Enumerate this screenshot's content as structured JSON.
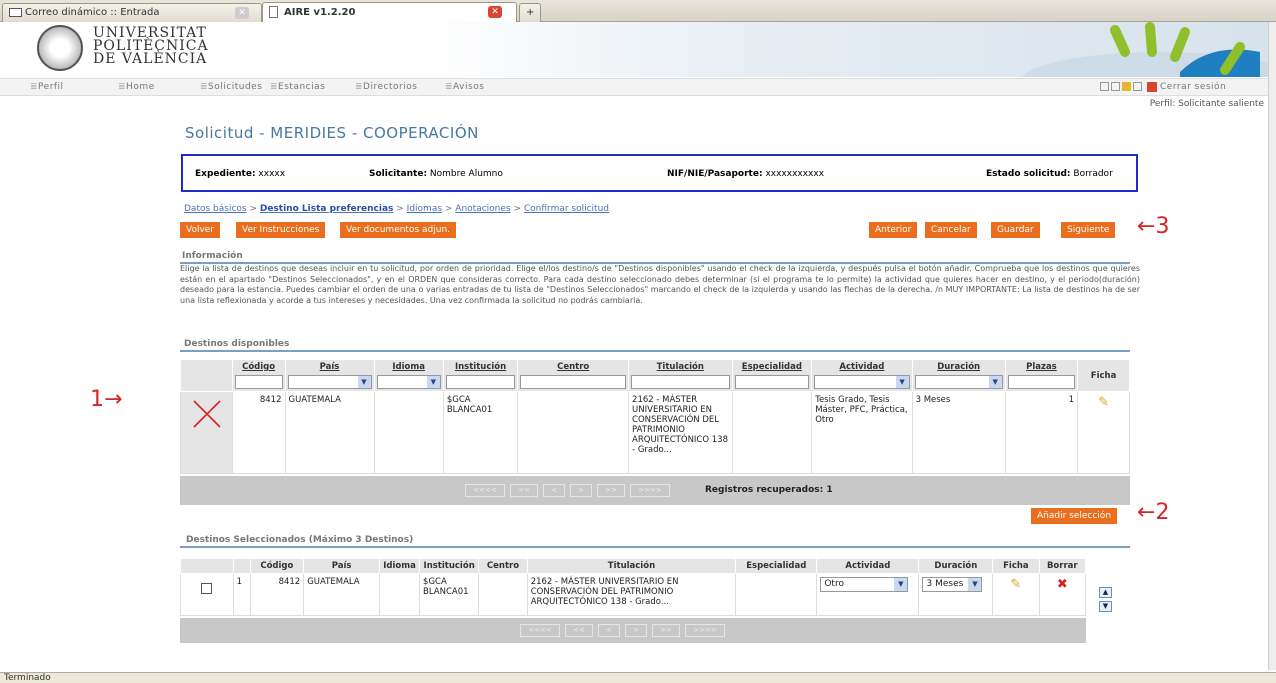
{
  "browser": {
    "tabs": [
      {
        "label": "Correo dinámico :: Entrada",
        "active": false
      },
      {
        "label": "AIRE v1.2.20",
        "active": true
      }
    ],
    "new_tab": "+",
    "status_text": "Terminado"
  },
  "header": {
    "logo_lines": [
      "UNIVERSITAT",
      "POLITÈCNICA",
      "DE VALÈNCIA"
    ]
  },
  "nav": {
    "items": [
      "Perfil",
      "Home",
      "Solicitudes",
      "Estancias",
      "Directorios",
      "Avisos"
    ],
    "logout": "Cerrar sesión",
    "profile": "Perfil: Solicitante saliente"
  },
  "page": {
    "title": "Solicitud - MERIDIES - COOPERACIÓN",
    "summary": {
      "expediente_label": "Expediente:",
      "expediente_value": "xxxxx",
      "solicitante_label": "Solicitante:",
      "solicitante_value": "Nombre Alumno",
      "nif_label": "NIF/NIE/Pasaporte:",
      "nif_value": "xxxxxxxxxxx",
      "estado_label": "Estado solicitud:",
      "estado_value": "Borrador"
    },
    "breadcrumb": [
      "Datos básicos",
      "Destino Lista preferencias",
      "Idiomas",
      "Anotaciones",
      "Confirmar solicitud"
    ],
    "left_buttons": [
      "Volver",
      "Ver Instrucciones",
      "Ver documentos adjun."
    ],
    "right_buttons": [
      "Anterior",
      "Cancelar",
      "Guardar",
      "Siguiente"
    ],
    "info_heading": "Información",
    "info_text": "Elige la lista de destinos que deseas incluir en tu solicitud, por orden de prioridad. Elige el/los destino/s de \"Destinos disponibles\" usando el check de la izquierda, y después pulsa el botón añadir. Comprueba que los destinos que quieres están en el apartado \"Destinos Seleccionados\", y en el ORDEN que consideras correcto. Para cada destino seleccionado debes determinar (si el programa te lo permite) la actividad que quieres hacer en destino, y el periodo(duración) deseado para la estancia. Puedes cambiar el orden de una o varias entradas de tu lista de \"Destinos Seleccionados\" marcando el check de la izquierda y usando las flechas de la derecha. /n MUY IMPORTANTE: La lista de destinos ha de ser una lista reflexionada y acorde a tus intereses y necesidades. Una vez confirmada la solicitud no podrás cambiarla.",
    "available_heading": "Destinos disponibles",
    "available": {
      "columns": [
        "Código",
        "País",
        "Idioma",
        "Institución",
        "Centro",
        "Titulación",
        "Especialidad",
        "Actividad",
        "Duración",
        "Plazas",
        "Ficha"
      ],
      "row": {
        "codigo": "8412",
        "pais": "GUATEMALA",
        "idioma": "",
        "institucion": "$GCA BLANCA01",
        "centro": "",
        "titulacion": "2162 - MÁSTER UNIVERSITARIO EN CONSERVACIÓN DEL PATRIMONIO ARQUITECTÓNICO 138 - Grado...",
        "especialidad": "",
        "actividad": "Tesis Grado, Tesis Máster, PFC, Práctica, Otro",
        "duracion": "3 Meses",
        "plazas": "1"
      },
      "pager": [
        "<<<<",
        "<<",
        "<",
        ">",
        ">>",
        ">>>>"
      ],
      "records_text": "Registros recuperados: 1"
    },
    "add_button": "Añadir selección",
    "selected_heading": "Destinos Seleccionados (Máximo 3 Destinos)",
    "selected": {
      "columns": [
        "Código",
        "País",
        "Idioma",
        "Institución",
        "Centro",
        "Titulación",
        "Especialidad",
        "Actividad",
        "Duración",
        "Ficha",
        "Borrar"
      ],
      "row": {
        "num": "1",
        "codigo": "8412",
        "pais": "GUATEMALA",
        "idioma": "",
        "institucion": "$GCA BLANCA01",
        "centro": "",
        "titulacion": "2162 - MÁSTER UNIVERSITARIO EN CONSERVACIÓN DEL PATRIMONIO ARQUITECTÓNICO 138 - Grado...",
        "especialidad": "",
        "actividad": "Otro",
        "duracion": "3 Meses"
      },
      "pager": [
        "<<<<",
        "<<",
        "<",
        ">",
        ">>",
        ">>>>"
      ]
    },
    "annotations": {
      "one": "1",
      "two": "2",
      "three": "3",
      "arrow_right": "→",
      "arrow_left": "←"
    }
  },
  "colors": {
    "accent": "#ea6e1e",
    "title": "#4877a5",
    "summary_border": "#1f2bc9",
    "annotation": "#d52525"
  },
  "icons": [
    "mail-icon",
    "page-icon",
    "close-icon",
    "pencil-icon",
    "delete-icon",
    "arrow-up-icon",
    "arrow-down-icon",
    "padlock-icon"
  ]
}
